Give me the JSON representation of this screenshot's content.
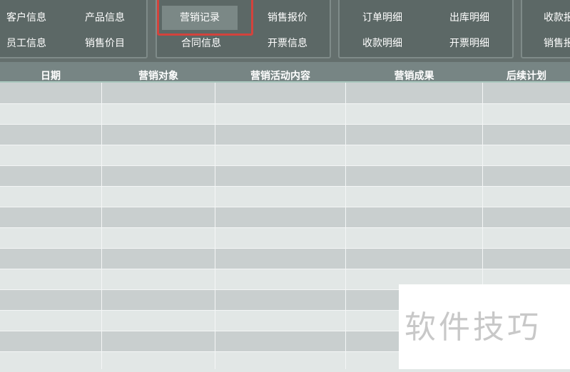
{
  "ribbon": {
    "groups": [
      {
        "buttons": [
          "客户信息",
          "产品信息",
          "员工信息",
          "销售价目"
        ]
      },
      {
        "buttons": [
          "营销记录",
          "销售报价",
          "合同信息",
          "开票信息"
        ],
        "selected": "营销记录"
      },
      {
        "buttons": [
          "订单明细",
          "出库明细",
          "收款明细",
          "开票明细"
        ]
      },
      {
        "buttons": [
          "收款报",
          "销售报"
        ]
      }
    ]
  },
  "table": {
    "columns": [
      "日期",
      "营销对象",
      "营销活动内容",
      "营销成果",
      "后续计划"
    ],
    "rows": 14
  },
  "watermark": {
    "text": "软件技巧"
  },
  "colors": {
    "ribbon": "#646f6d",
    "header": "#778584",
    "row_odd": "#c9cfcf",
    "row_even": "#e2e7e6",
    "highlight": "#d3433c"
  }
}
